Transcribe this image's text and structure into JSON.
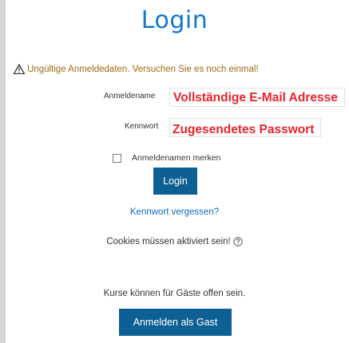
{
  "page": {
    "title": "Login"
  },
  "error": {
    "icon": "warning-icon",
    "message": "Ungültige Anmeldedaten. Versuchen Sie es noch einmal!"
  },
  "form": {
    "username_label": "Anmeldename",
    "username_overlay": "Vollständige E-Mail Adresse",
    "password_label": "Kennwort",
    "password_overlay": "Zugesendetes Passwort",
    "remember_label": "Anmeldenamen merken",
    "remember_checked": false,
    "login_button": "Login",
    "forgot_link": "Kennwort vergessen?",
    "cookies_text": "Cookies müssen aktiviert sein!",
    "cookies_help_icon": "help-icon"
  },
  "guest": {
    "text": "Kurse können für Gäste offen sein.",
    "button": "Anmelden als Gast"
  },
  "colors": {
    "title": "#1177d1",
    "warning": "#a06b15",
    "overlay": "#e8242d",
    "button_bg": "#0e5f94",
    "link": "#0f6cbf"
  }
}
